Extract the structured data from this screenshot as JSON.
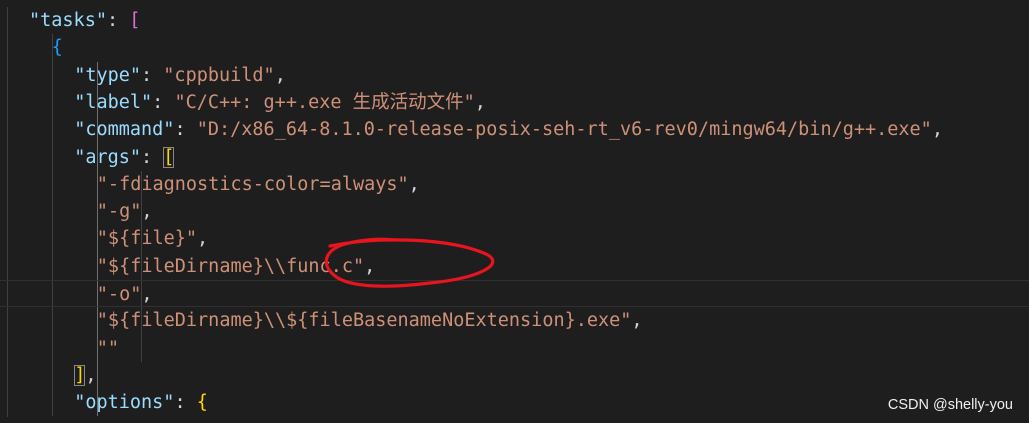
{
  "editor": {
    "lines": [
      {
        "indent": 2,
        "tokens": [
          {
            "t": "\"tasks\"",
            "c": "key"
          },
          {
            "t": ": ",
            "c": "punc"
          },
          {
            "t": "[",
            "c": "b1"
          }
        ]
      },
      {
        "indent": 4,
        "tokens": [
          {
            "t": "{",
            "c": "b2"
          }
        ]
      },
      {
        "indent": 6,
        "tokens": [
          {
            "t": "\"type\"",
            "c": "key"
          },
          {
            "t": ": ",
            "c": "punc"
          },
          {
            "t": "\"cppbuild\"",
            "c": "str"
          },
          {
            "t": ",",
            "c": "punc"
          }
        ]
      },
      {
        "indent": 6,
        "tokens": [
          {
            "t": "\"label\"",
            "c": "key"
          },
          {
            "t": ": ",
            "c": "punc"
          },
          {
            "t": "\"C/C++: g++.exe 生成活动文件\"",
            "c": "str"
          },
          {
            "t": ",",
            "c": "punc"
          }
        ]
      },
      {
        "indent": 6,
        "tokens": [
          {
            "t": "\"command\"",
            "c": "key"
          },
          {
            "t": ": ",
            "c": "punc"
          },
          {
            "t": "\"D:/x86_64-8.1.0-release-posix-seh-rt_v6-rev0/mingw64/bin/g++.exe\"",
            "c": "str"
          },
          {
            "t": ",",
            "c": "punc"
          }
        ]
      },
      {
        "indent": 6,
        "tokens": [
          {
            "t": "\"args\"",
            "c": "key"
          },
          {
            "t": ": ",
            "c": "punc"
          },
          {
            "t": "[",
            "c": "b3 matched"
          }
        ]
      },
      {
        "indent": 8,
        "tokens": [
          {
            "t": "\"-fdiagnostics-color=always\"",
            "c": "str"
          },
          {
            "t": ",",
            "c": "punc"
          }
        ]
      },
      {
        "indent": 8,
        "tokens": [
          {
            "t": "\"-g\"",
            "c": "str"
          },
          {
            "t": ",",
            "c": "punc"
          }
        ]
      },
      {
        "indent": 8,
        "tokens": [
          {
            "t": "\"${file}\"",
            "c": "str"
          },
          {
            "t": ",",
            "c": "punc"
          }
        ]
      },
      {
        "indent": 8,
        "tokens": [
          {
            "t": "\"${fileDirname}\\\\func.c\"",
            "c": "str"
          },
          {
            "t": ",",
            "c": "punc"
          }
        ]
      },
      {
        "indent": 8,
        "tokens": [
          {
            "t": "\"-o\"",
            "c": "str"
          },
          {
            "t": ",",
            "c": "punc"
          }
        ]
      },
      {
        "indent": 8,
        "tokens": [
          {
            "t": "\"${fileDirname}\\\\${fileBasenameNoExtension}.exe\"",
            "c": "str"
          },
          {
            "t": ",",
            "c": "punc"
          }
        ]
      },
      {
        "indent": 8,
        "tokens": [
          {
            "t": "\"\"",
            "c": "str"
          }
        ]
      },
      {
        "indent": 6,
        "tokens": [
          {
            "t": "]",
            "c": "b3 matched"
          },
          {
            "t": ",",
            "c": "punc"
          }
        ]
      },
      {
        "indent": 6,
        "tokens": [
          {
            "t": "\"options\"",
            "c": "key"
          },
          {
            "t": ": ",
            "c": "punc"
          },
          {
            "t": "{",
            "c": "b3"
          }
        ]
      }
    ],
    "current_line": 10
  },
  "watermark": "CSDN @shelly-you",
  "colors": {
    "background": "#1e1e1e",
    "json_key": "#9cdcfe",
    "json_string": "#ce9178",
    "bracket_level1": "#da70d6",
    "bracket_level2": "#179fff",
    "bracket_level3": "#ffd700",
    "annotation": "#e8141e"
  }
}
